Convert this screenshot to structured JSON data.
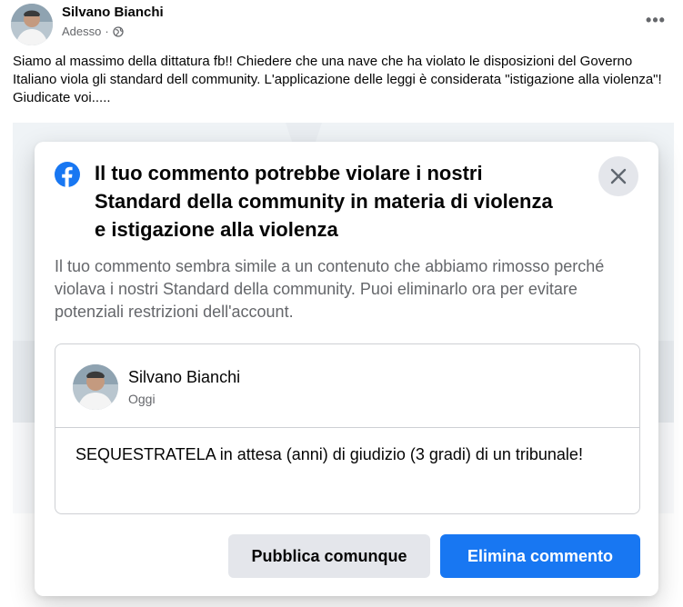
{
  "post": {
    "author": "Silvano Bianchi",
    "time": "Adesso",
    "separator": "·",
    "privacy_icon": "globe-icon",
    "more_label": "•••",
    "text": "Siamo al massimo della dittatura fb!! Chiedere che una nave che ha violato le disposizioni del Governo Italiano viola gli standard dell community. L'applicazione delle leggi è considerata \"istigazione alla violenza\"! Giudicate voi....."
  },
  "dialog": {
    "logo_icon": "facebook-logo-icon",
    "title": "Il tuo commento potrebbe violare i nostri Standard della community in materia di violenza e istigazione alla violenza",
    "close_icon": "close-icon",
    "description": "Il tuo commento sembra simile a un contenuto che abbiamo rimosso perché violava i nostri Standard della community. Puoi eliminarlo ora per evitare potenziali restrizioni dell'account.",
    "comment": {
      "author": "Silvano Bianchi",
      "time": "Oggi",
      "text": "SEQUESTRATELA in attesa (anni) di giudizio (3 gradi) di un tribunale!"
    },
    "secondary_button": "Pubblica comunque",
    "primary_button": "Elimina commento"
  },
  "colors": {
    "primary": "#1877f2",
    "secondary_bg": "#e4e6eb",
    "muted_text": "#65676b"
  }
}
